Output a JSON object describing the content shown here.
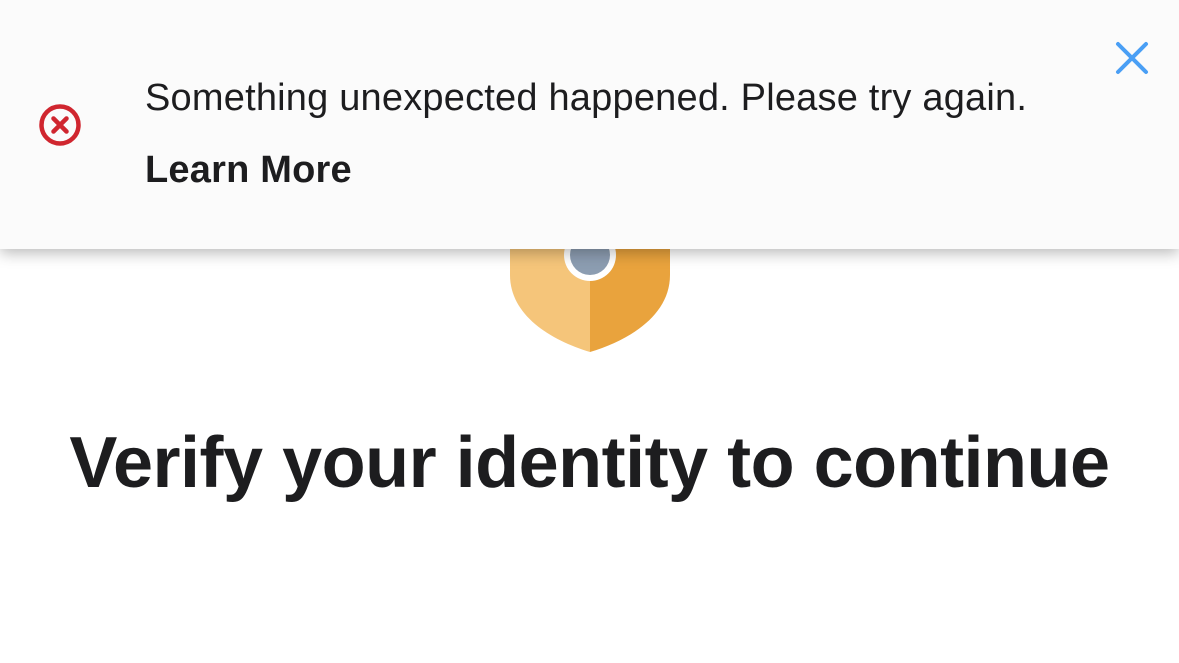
{
  "banner": {
    "message": "Something unexpected happened. Please try again.",
    "learn_more_label": "Learn More",
    "error_icon": "error-circle-icon",
    "close_icon": "close-icon",
    "error_color": "#d0262f",
    "close_color": "#4a9ff5"
  },
  "main": {
    "shield_icon": "shield-icon",
    "shield_colors": [
      "#f5c57a",
      "#e9a33d",
      "#8c9db1"
    ],
    "title": "Verify your identity to continue"
  }
}
